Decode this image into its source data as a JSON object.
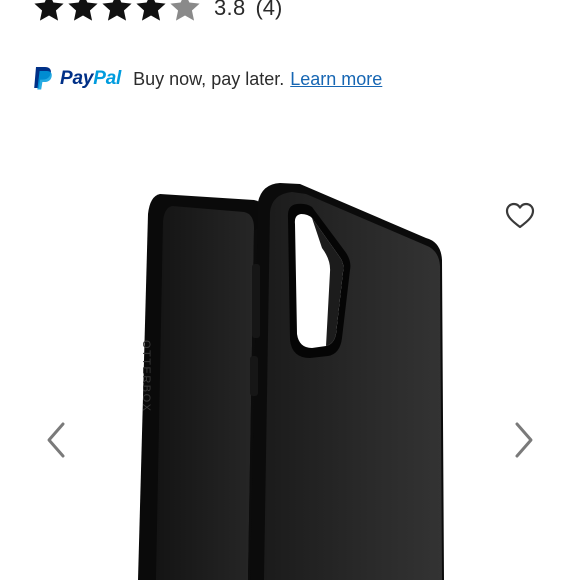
{
  "rating": {
    "value_text": "3.8",
    "count_text": "(4)",
    "value": 3.8,
    "max": 5,
    "star_color": "#111111",
    "empty_star_color": "#8a8a8a"
  },
  "paypal": {
    "brand_pay": "Pay",
    "brand_pal": "Pal",
    "message": "Buy now, pay later.",
    "link_label": "Learn more",
    "colors": {
      "dark_blue": "#003087",
      "light_blue": "#009cde",
      "link": "#1666b3"
    }
  },
  "gallery": {
    "image_alt": "OtterBox phone case, black",
    "case_text": "OTTERBOX",
    "icons": {
      "prev": "chevron-left-icon",
      "next": "chevron-right-icon",
      "favorite": "heart-icon"
    }
  }
}
